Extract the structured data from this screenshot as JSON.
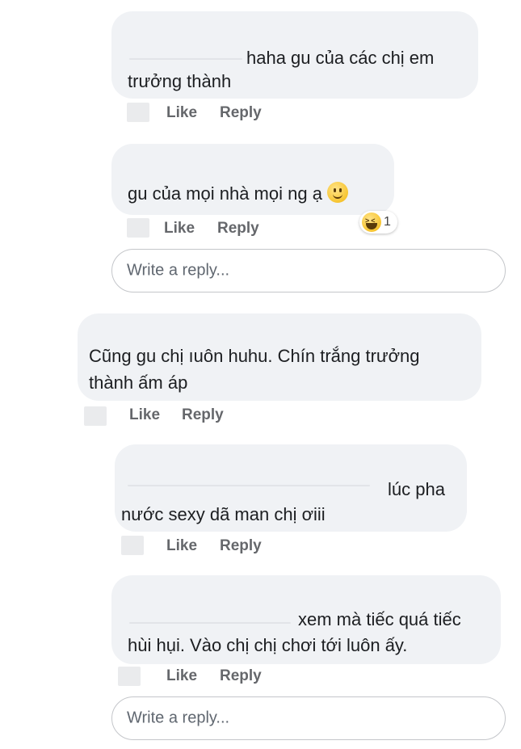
{
  "comments": [
    {
      "line1": "haha gu của các chị em",
      "line2": "trưởng thành"
    },
    {
      "line1": "gu của mọi nhà mọi ng ạ",
      "emoji": "slightly-smiling-face-icon",
      "reaction_count": "1"
    },
    {
      "line1": "Cũng gu chị ıuôn huhu. Chín trắng trưởng",
      "line2": "thành ấm áp"
    },
    {
      "line1": "lúc pha",
      "line2": "nước sexy dã man chị ơiii"
    },
    {
      "line1": "xem mà tiếc quá tiếc",
      "line2": "hùi hụi. Vào chị chị chơi tới luôn ấy."
    }
  ],
  "actions": {
    "like": "Like",
    "reply": "Reply"
  },
  "reply_box": {
    "placeholder": "Write a reply..."
  }
}
